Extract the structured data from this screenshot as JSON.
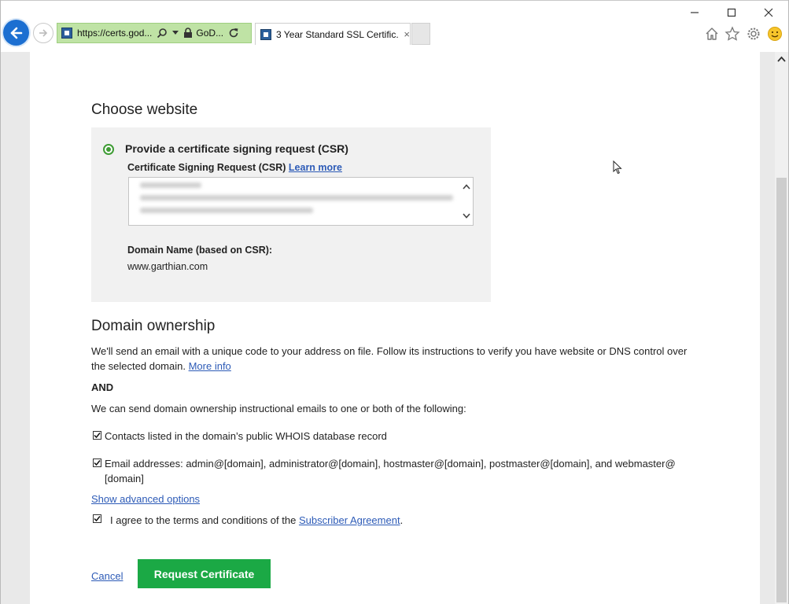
{
  "browser": {
    "address_bar": {
      "url": "https://certs.god...",
      "site_identity": "GoD..."
    },
    "tab": {
      "title": "3 Year Standard SSL Certific...",
      "close": "×"
    },
    "window_controls": {
      "minimize": "—",
      "maximize": "☐",
      "close": "✕"
    }
  },
  "page": {
    "choose_website": {
      "heading": "Choose website",
      "option_label": "Provide a certificate signing request (CSR)",
      "csr_field_label": "Certificate Signing Request (CSR)",
      "learn_more": "Learn more",
      "domain_label": "Domain Name (based on CSR):",
      "domain_value": "www.garthian.com"
    },
    "domain_ownership": {
      "heading": "Domain ownership",
      "description_line1": "We'll send an email with a unique code to your address on file. Follow its instructions to verify you have website or DNS control over",
      "description_line2": "the selected domain.",
      "more_info": "More info",
      "and_label": "AND",
      "instructional_text": "We can send domain ownership instructional emails to one or both of the following:",
      "option_whois": "Contacts listed in the domain’s public WHOIS database record",
      "option_emails_line1": "Email addresses: admin@[domain], administrator@[domain], hostmaster@[domain], postmaster@[domain], and webmaster@",
      "option_emails_line2": "[domain]",
      "show_advanced": "Show advanced options",
      "agree_prefix": "I agree to the terms and conditions of the",
      "subscriber_agreement": "Subscriber Agreement",
      "agree_suffix": "."
    },
    "actions": {
      "cancel": "Cancel",
      "request_certificate": "Request Certificate"
    }
  },
  "colors": {
    "accent_green": "#1ba945",
    "radio_green": "#3f9c35",
    "link_blue": "#2d5bb7",
    "address_bar_green": "#bfe3a5",
    "back_button_blue": "#1c6fd1"
  },
  "icons": [
    "back-arrow-icon",
    "forward-arrow-icon",
    "search-icon",
    "dropdown-icon",
    "lock-icon",
    "refresh-icon",
    "home-icon",
    "favorites-star-icon",
    "settings-gear-icon",
    "smiley-feedback-icon",
    "scroll-up-icon",
    "cursor-icon"
  ]
}
